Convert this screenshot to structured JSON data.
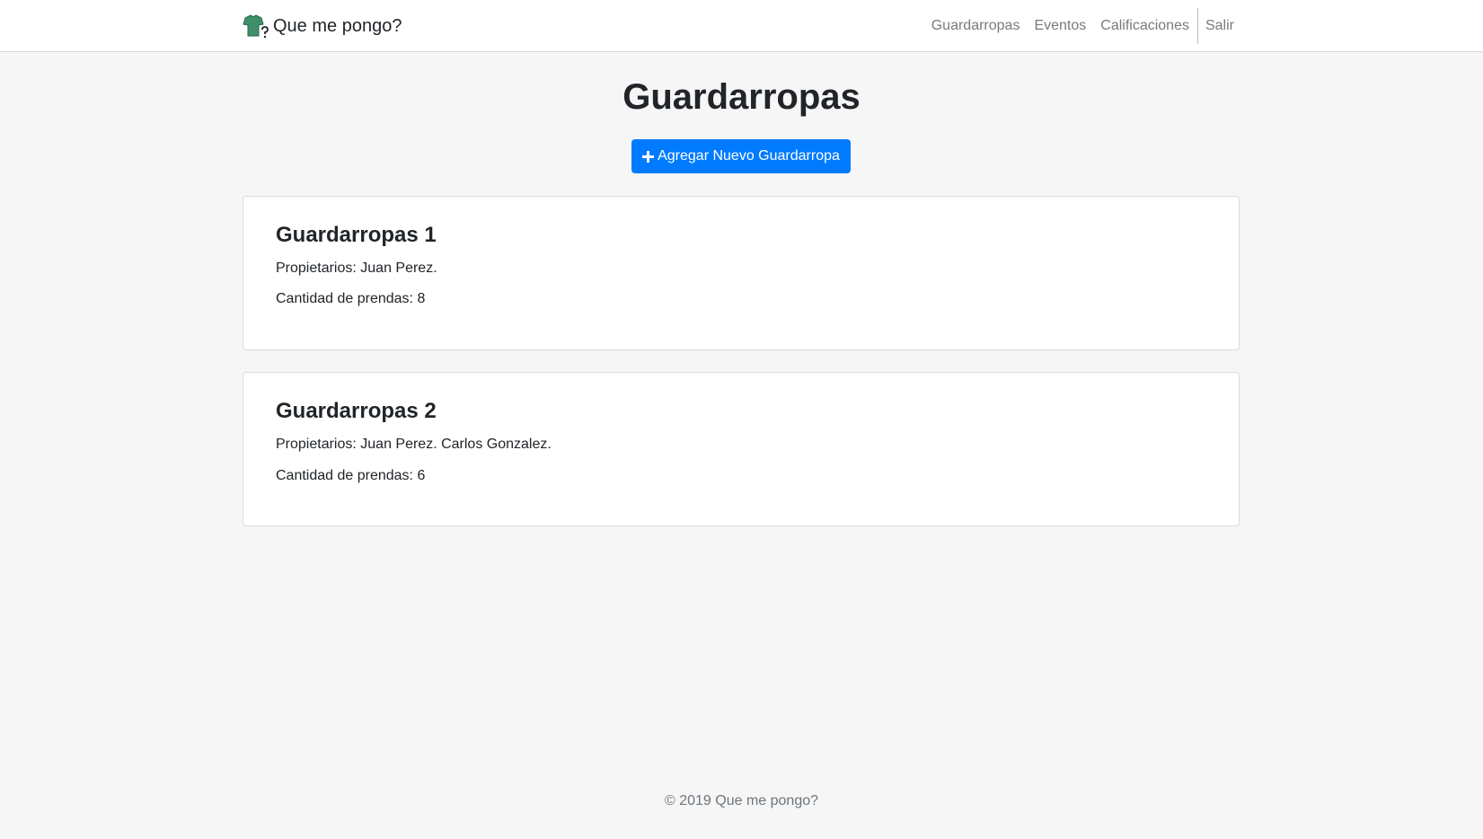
{
  "navbar": {
    "brand": "Que me pongo?",
    "brand_icon": "shirt-question-icon",
    "links": [
      "Guardarropas",
      "Eventos",
      "Calificaciones"
    ],
    "logout": "Salir"
  },
  "main": {
    "title": "Guardarropas",
    "add_button": "Agregar Nuevo Guardarropa",
    "add_icon": "plus-icon",
    "accent_color": "#007bff",
    "wardrobes": [
      {
        "name": "Guardarropas 1",
        "owners": "Propietarios: Juan Perez.",
        "count": "Cantidad de prendas: 8"
      },
      {
        "name": "Guardarropas 2",
        "owners": "Propietarios: Juan Perez. Carlos Gonzalez.",
        "count": "Cantidad de prendas: 6"
      }
    ]
  },
  "footer": {
    "text": "© 2019 Que me pongo?"
  }
}
